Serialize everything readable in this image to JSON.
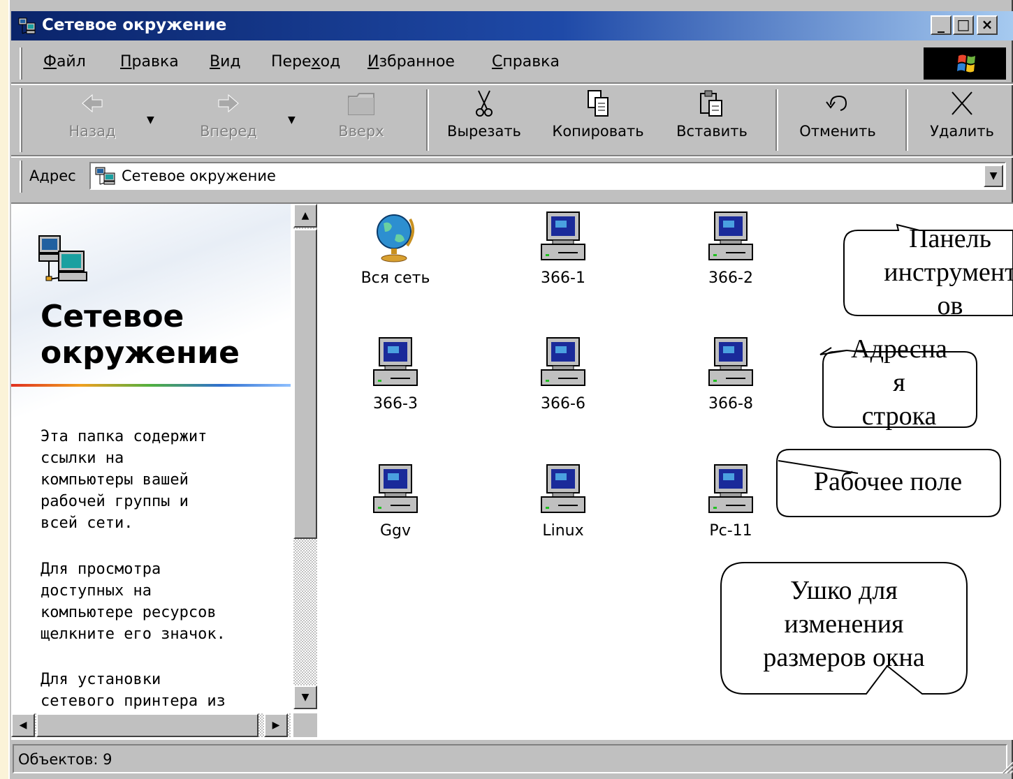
{
  "window": {
    "title": "Сетевое окружение",
    "controls": {
      "minimize": "_",
      "maximize": "□",
      "close": "×"
    }
  },
  "menu": {
    "items": [
      {
        "label": "Файл",
        "accel": "Ф"
      },
      {
        "label": "Правка",
        "accel": "П"
      },
      {
        "label": "Вид",
        "accel": "В"
      },
      {
        "label": "Переход",
        "accel": "х"
      },
      {
        "label": "Избранное",
        "accel": "И"
      },
      {
        "label": "Справка",
        "accel": "С"
      }
    ]
  },
  "toolbar": {
    "back": "Назад",
    "forward": "Вперед",
    "up": "Вверх",
    "cut": "Вырезать",
    "copy": "Копировать",
    "paste": "Вставить",
    "undo": "Отменить",
    "delete": "Удалить"
  },
  "address": {
    "label": "Адрес",
    "value": "Сетевое окружение"
  },
  "leftpane": {
    "title": "Сетевое окружение",
    "para1": "Эта папка содержит\nссылки на\nкомпьютеры вашей\nрабочей группы и\nвсей сети.",
    "para2": "Для просмотра\nдоступных на\nкомпьютере ресурсов\nщелкните его значок.",
    "para3": "Для установки\nсетевого принтера из"
  },
  "items": [
    "Вся сеть",
    "366-1",
    "366-2",
    "366-3",
    "366-6",
    "366-8",
    "Ggv",
    "Linux",
    "Pc-11"
  ],
  "status": {
    "text": "Объектов: 9"
  },
  "callouts": {
    "toolbar": "Панель\nинструмент\nов",
    "address": "Адресна\nя\nстрока",
    "workspace": "Рабочее поле",
    "resize": "Ушко для\nизменения\nразмеров окна"
  },
  "colors": {
    "titlebar_start": "#0a246a",
    "titlebar_end": "#a6caf0",
    "window_face": "#c0c0c0",
    "slide_background": "#fbf3d8"
  }
}
